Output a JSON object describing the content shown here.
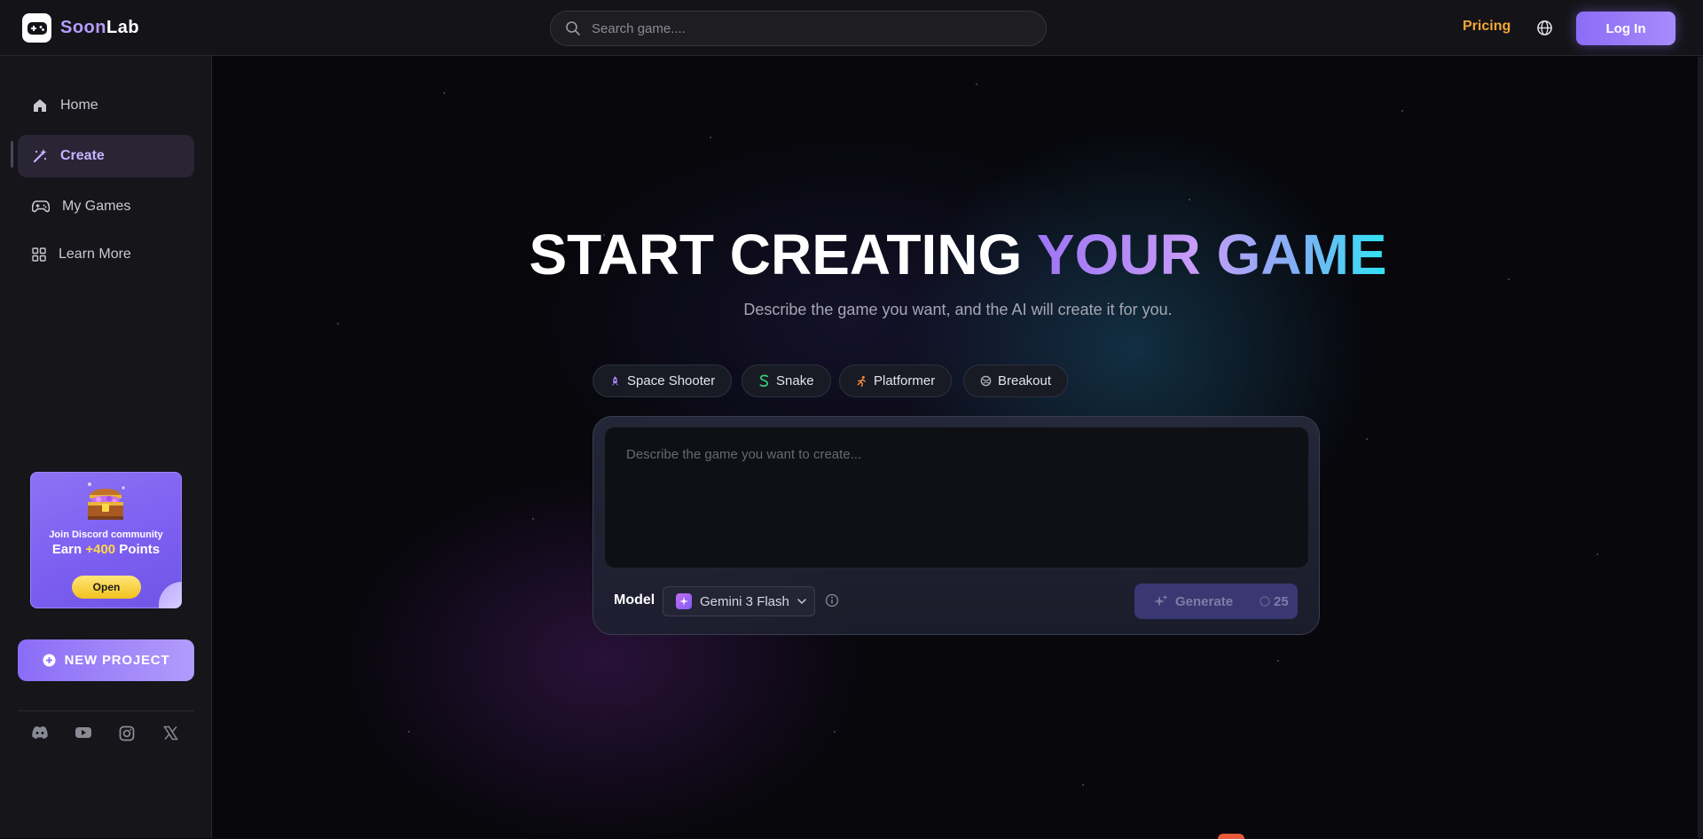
{
  "header": {
    "logo_text_1": "Soon",
    "logo_text_2": "Lab",
    "search_placeholder": "Search game....",
    "pricing_label": "Pricing",
    "login_label": "Log In"
  },
  "sidebar": {
    "items": [
      {
        "label": "Home",
        "icon": "home-icon"
      },
      {
        "label": "Create",
        "icon": "magic-wand-icon",
        "active": true
      },
      {
        "label": "My Games",
        "icon": "gamepad-icon"
      },
      {
        "label": "Learn More",
        "icon": "grid-icon"
      }
    ],
    "discord_card": {
      "line1": "Join Discord community",
      "line2_prefix": "Earn ",
      "line2_points": "+400",
      "line2_suffix": " Points",
      "open_label": "Open"
    },
    "new_project_label": "NEW PROJECT",
    "social": [
      "discord-icon",
      "youtube-icon",
      "instagram-icon",
      "x-icon"
    ]
  },
  "hero": {
    "title_white": "START CREATING ",
    "title_gradient": "YOUR GAME",
    "subtitle": "Describe the game you want, and the AI will create it for you."
  },
  "chips": [
    {
      "label": "Space Shooter",
      "icon": "rocket-icon"
    },
    {
      "label": "Snake",
      "icon": "snake-icon"
    },
    {
      "label": "Platformer",
      "icon": "runner-icon"
    },
    {
      "label": "Breakout",
      "icon": "ball-icon"
    }
  ],
  "composer": {
    "placeholder": "Describe the game you want to create...",
    "model_label": "Model",
    "model_value": "Gemini 3 Flash",
    "generate_label": "Generate",
    "generate_cost": "25"
  },
  "colors": {
    "accent": "#8b6cf6",
    "pricing": "#f3a634",
    "points": "#ffd84a"
  }
}
